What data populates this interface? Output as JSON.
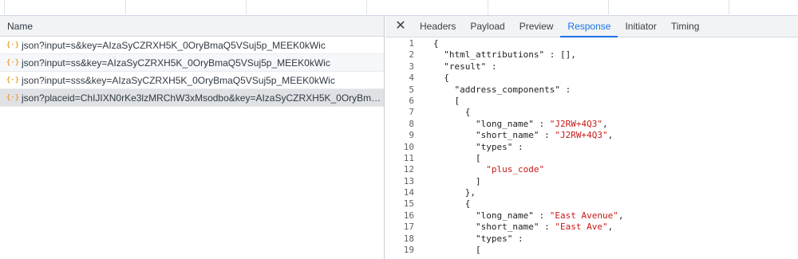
{
  "request_list": {
    "header": "Name",
    "rows": [
      {
        "text": "json?input=s&key=AIzaSyCZRXH5K_0OryBmaQ5VSuj5p_MEEK0kWic"
      },
      {
        "text": "json?input=ss&key=AIzaSyCZRXH5K_0OryBmaQ5VSuj5p_MEEK0kWic"
      },
      {
        "text": "json?input=sss&key=AIzaSyCZRXH5K_0OryBmaQ5VSuj5p_MEEK0kWic"
      },
      {
        "text": "json?placeid=ChIJIXN0rKe3lzMRChW3xMsodbo&key=AIzaSyCZRXH5K_0OryBmaQ...",
        "selected": true
      }
    ],
    "icon": "json-icon"
  },
  "details": {
    "close_icon": "close-icon",
    "tabs": [
      "Headers",
      "Payload",
      "Preview",
      "Response",
      "Initiator",
      "Timing"
    ],
    "active_tab": "Response"
  },
  "response_lines": [
    {
      "n": "1",
      "indent": 0,
      "parts": [
        [
          "p",
          "{"
        ]
      ]
    },
    {
      "n": "2",
      "indent": 1,
      "parts": [
        [
          "k",
          "\"html_attributions\""
        ],
        [
          "p",
          " : [],"
        ]
      ]
    },
    {
      "n": "3",
      "indent": 1,
      "parts": [
        [
          "k",
          "\"result\""
        ],
        [
          "p",
          " :"
        ]
      ]
    },
    {
      "n": "4",
      "indent": 1,
      "parts": [
        [
          "p",
          "{"
        ]
      ]
    },
    {
      "n": "5",
      "indent": 2,
      "parts": [
        [
          "k",
          "\"address_components\""
        ],
        [
          "p",
          " :"
        ]
      ]
    },
    {
      "n": "6",
      "indent": 2,
      "parts": [
        [
          "p",
          "["
        ]
      ]
    },
    {
      "n": "7",
      "indent": 3,
      "parts": [
        [
          "p",
          "{"
        ]
      ]
    },
    {
      "n": "8",
      "indent": 4,
      "parts": [
        [
          "k",
          "\"long_name\""
        ],
        [
          "p",
          " : "
        ],
        [
          "s",
          "\"J2RW+4Q3\""
        ],
        [
          "p",
          ","
        ]
      ]
    },
    {
      "n": "9",
      "indent": 4,
      "parts": [
        [
          "k",
          "\"short_name\""
        ],
        [
          "p",
          " : "
        ],
        [
          "s",
          "\"J2RW+4Q3\""
        ],
        [
          "p",
          ","
        ]
      ]
    },
    {
      "n": "10",
      "indent": 4,
      "parts": [
        [
          "k",
          "\"types\""
        ],
        [
          "p",
          " :"
        ]
      ]
    },
    {
      "n": "11",
      "indent": 4,
      "parts": [
        [
          "p",
          "["
        ]
      ]
    },
    {
      "n": "12",
      "indent": 5,
      "parts": [
        [
          "s",
          "\"plus_code\""
        ]
      ]
    },
    {
      "n": "13",
      "indent": 4,
      "parts": [
        [
          "p",
          "]"
        ]
      ]
    },
    {
      "n": "14",
      "indent": 3,
      "parts": [
        [
          "p",
          "},"
        ]
      ]
    },
    {
      "n": "15",
      "indent": 3,
      "parts": [
        [
          "p",
          "{"
        ]
      ]
    },
    {
      "n": "16",
      "indent": 4,
      "parts": [
        [
          "k",
          "\"long_name\""
        ],
        [
          "p",
          " : "
        ],
        [
          "s",
          "\"East Avenue\""
        ],
        [
          "p",
          ","
        ]
      ]
    },
    {
      "n": "17",
      "indent": 4,
      "parts": [
        [
          "k",
          "\"short_name\""
        ],
        [
          "p",
          " : "
        ],
        [
          "s",
          "\"East Ave\""
        ],
        [
          "p",
          ","
        ]
      ]
    },
    {
      "n": "18",
      "indent": 4,
      "parts": [
        [
          "k",
          "\"types\""
        ],
        [
          "p",
          " :"
        ]
      ]
    },
    {
      "n": "19",
      "indent": 4,
      "parts": [
        [
          "p",
          "["
        ]
      ]
    }
  ]
}
